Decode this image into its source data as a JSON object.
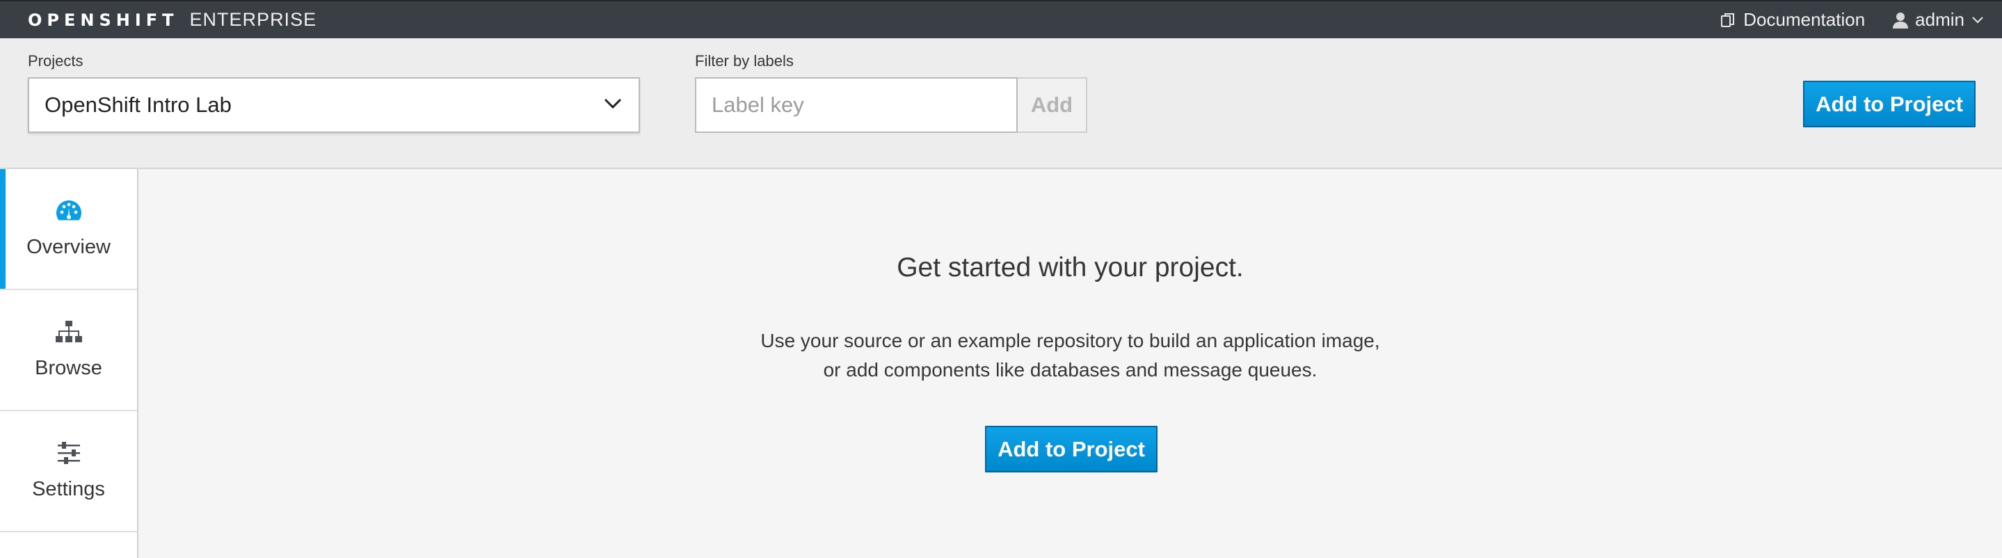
{
  "header": {
    "brand_bold": "OPENSHIFT",
    "brand_light": "ENTERPRISE",
    "documentation_label": "Documentation",
    "user_label": "admin"
  },
  "toolbar": {
    "projects_label": "Projects",
    "selected_project": "OpenShift Intro Lab",
    "filter_label": "Filter by labels",
    "label_key_placeholder": "Label key",
    "label_add_button": "Add",
    "add_to_project_button": "Add to Project"
  },
  "sidebar": {
    "items": [
      {
        "label": "Overview",
        "icon": "dashboard-icon",
        "active": true
      },
      {
        "label": "Browse",
        "icon": "sitemap-icon",
        "active": false
      },
      {
        "label": "Settings",
        "icon": "sliders-icon",
        "active": false
      }
    ]
  },
  "main": {
    "title": "Get started with your project.",
    "description_line1": "Use your source or an example repository to build an application image,",
    "description_line2": "or add components like databases and message queues.",
    "add_to_project_button": "Add to Project"
  },
  "colors": {
    "masthead": "#393f44",
    "toolbar": "#ededed",
    "primary": "#0088ce",
    "active_indicator": "#0a9ee5"
  }
}
